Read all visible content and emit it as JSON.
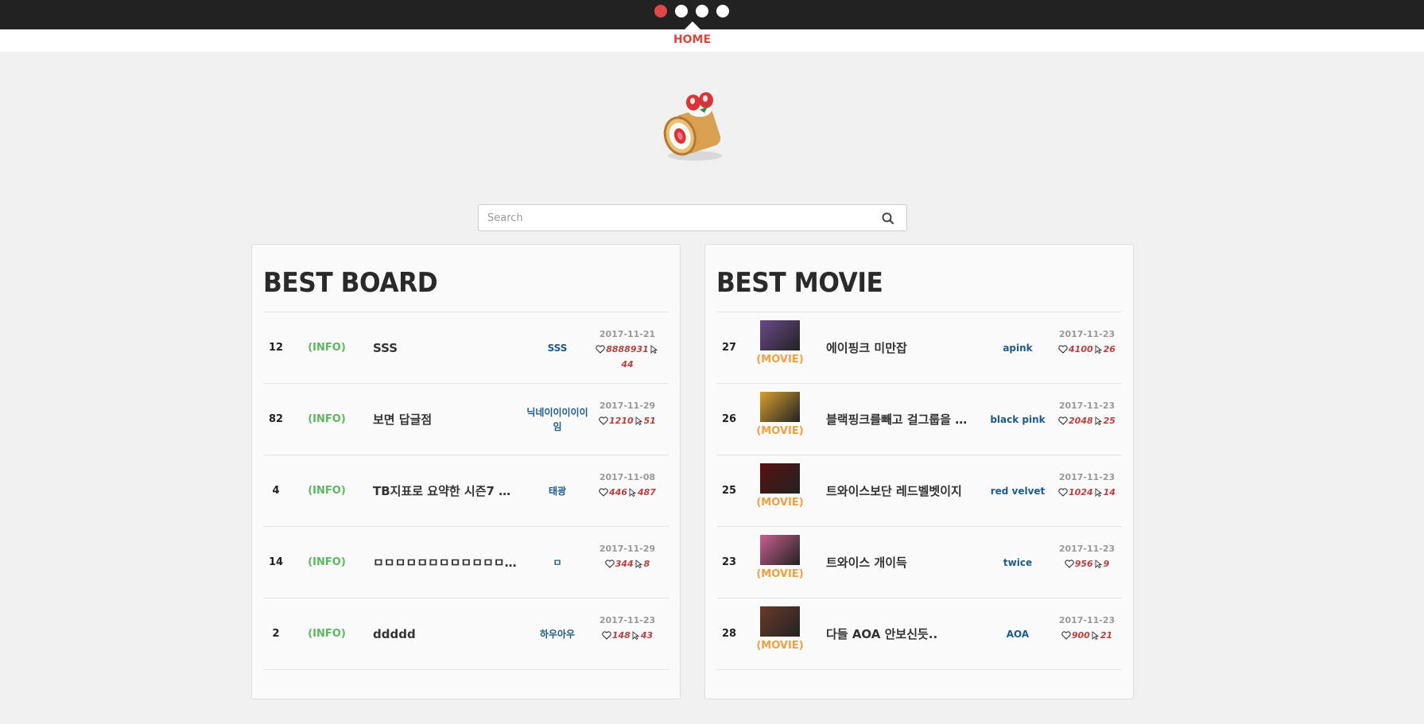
{
  "nav": {
    "dots": [
      {
        "name": "page-dot-1",
        "active": true
      },
      {
        "name": "page-dot-2",
        "active": false
      },
      {
        "name": "page-dot-3",
        "active": false
      },
      {
        "name": "page-dot-4",
        "active": false
      }
    ],
    "home_label": "HOME"
  },
  "logo": {
    "icon": "roll-cake-logo"
  },
  "search": {
    "placeholder": "Search",
    "value": "",
    "icon": "search-icon"
  },
  "colors": {
    "accent": "#e04848",
    "info": "#5cb85c",
    "movie": "#f0a040",
    "author": "#1e5a8a",
    "stat": "#b94040"
  },
  "board": {
    "title": "BEST BOARD",
    "rows": [
      {
        "num": "12",
        "category": "(INFO)",
        "title": "SSS",
        "author": "SSS",
        "date": "2017-11-21",
        "likes": "8888931",
        "views": "44"
      },
      {
        "num": "82",
        "category": "(INFO)",
        "title": "보면 답글점",
        "author": "닉네이이이이이임",
        "date": "2017-11-29",
        "likes": "1210",
        "views": "51"
      },
      {
        "num": "4",
        "category": "(INFO)",
        "title": "TB지표로 요약한 시즌7 …",
        "author": "태광",
        "date": "2017-11-08",
        "likes": "446",
        "views": "487"
      },
      {
        "num": "14",
        "category": "(INFO)",
        "title": "ㅁㅁㅁㅁㅁㅁㅁㅁㅁㅁㅁㅁㅁㅁㅁ…",
        "author": "ㅁ",
        "date": "2017-11-29",
        "likes": "344",
        "views": "8"
      },
      {
        "num": "2",
        "category": "(INFO)",
        "title": "ddddd",
        "author": "하우아우",
        "date": "2017-11-23",
        "likes": "148",
        "views": "43"
      }
    ]
  },
  "movie": {
    "title": "BEST MOVIE",
    "rows": [
      {
        "num": "27",
        "category": "(MOVIE)",
        "title": "에이핑크 미만잡",
        "author": "apink",
        "date": "2017-11-23",
        "likes": "4100",
        "views": "26",
        "thumb_color": "#6a4a8a"
      },
      {
        "num": "26",
        "category": "(MOVIE)",
        "title": "블랙핑크를빼고 걸그룹을 …",
        "author": "black pink",
        "date": "2017-11-23",
        "likes": "2048",
        "views": "25",
        "thumb_color": "#d8a030"
      },
      {
        "num": "25",
        "category": "(MOVIE)",
        "title": "트와이스보단 레드벨벳이지",
        "author": "red velvet",
        "date": "2017-11-23",
        "likes": "1024",
        "views": "14",
        "thumb_color": "#5a1010"
      },
      {
        "num": "23",
        "category": "(MOVIE)",
        "title": "트와이스 개이득",
        "author": "twice",
        "date": "2017-11-23",
        "likes": "956",
        "views": "9",
        "thumb_color": "#c86090"
      },
      {
        "num": "28",
        "category": "(MOVIE)",
        "title": "다들 AOA 안보신듯..",
        "author": "AOA",
        "date": "2017-11-23",
        "likes": "900",
        "views": "21",
        "thumb_color": "#6a3a2a"
      }
    ]
  }
}
